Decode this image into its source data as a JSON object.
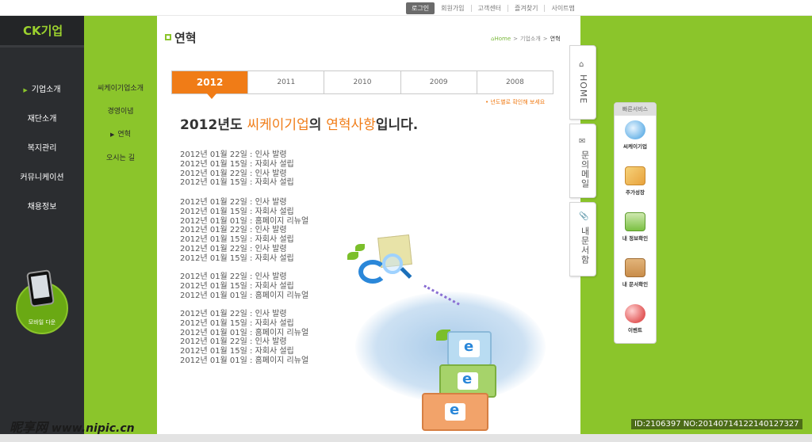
{
  "topbar": {
    "login": "로그인",
    "links": [
      "회원가입",
      "고객센터",
      "즐겨찾기",
      "사이트맵"
    ]
  },
  "logo": "CK기업",
  "leftnav": {
    "items": [
      {
        "label": "기업소개",
        "active": true
      },
      {
        "label": "재단소개",
        "active": false
      },
      {
        "label": "복지관리",
        "active": false
      },
      {
        "label": "커뮤니케이션",
        "active": false
      },
      {
        "label": "채용정보",
        "active": false
      }
    ],
    "mobile_label": "모바일 다운"
  },
  "subnav": {
    "items": [
      {
        "label": "씨케이기업소개",
        "active": false
      },
      {
        "label": "경영이념",
        "active": false
      },
      {
        "label": "연혁",
        "active": true
      },
      {
        "label": "오시는 길",
        "active": false
      }
    ]
  },
  "page": {
    "title": "연혁",
    "breadcrumb": [
      "Home",
      "기업소개",
      "연혁"
    ]
  },
  "tabs": [
    "2012",
    "2011",
    "2010",
    "2009",
    "2008"
  ],
  "year_note": "• 년도별로 확인해 보세요",
  "headline": {
    "pre": "2012년도 ",
    "company": "씨케이기업",
    "mid": "의 ",
    "topic": "연혁사항",
    "post": "입니다."
  },
  "history": [
    [
      "2012년 01월 22일 : 인사 발령",
      "2012년 01월 15일 : 자회사 설립",
      "2012년 01월 22일 : 인사 발령",
      "2012년 01월 15일 : 자회사 설립"
    ],
    [
      "2012년 01월 22일 : 인사 발령",
      "2012년 01월 15일 : 자회사 설립",
      "2012년 01월 01일 : 홈페이지 리뉴얼",
      "2012년 01월 22일 : 인사 발령",
      "2012년 01월 15일 : 자회사 설립",
      "2012년 01월 22일 : 인사 발령",
      "2012년 01월 15일 : 자회사 설립"
    ],
    [
      "2012년 01월 22일 : 인사 발령",
      "2012년 01월 15일 : 자회사 설립",
      "2012년 01월 01일 : 홈페이지 리뉴얼"
    ],
    [
      "2012년 01월 22일 : 인사 발령",
      "2012년 01월 15일 : 자회사 설립",
      "2012년 01월 01일 : 홈페이지 리뉴얼",
      "2012년 01월 22일 : 인사 발령",
      "2012년 01월 15일 : 자회사 설립",
      "2012년 01월 01일 : 홈페이지 리뉴얼"
    ]
  ],
  "vtabs": [
    {
      "label": "HOME",
      "icon": "home-icon"
    },
    {
      "label": "문의메일",
      "icon": "mail-icon"
    },
    {
      "label": "내문서함",
      "icon": "clip-icon"
    }
  ],
  "quick": {
    "title": "빠른서비스",
    "items": [
      {
        "label": "씨케이기업",
        "icon": "globe-icon",
        "color": "#6fb6e8"
      },
      {
        "label": "주가성장",
        "icon": "chart-up-icon",
        "color": "#e8a23c"
      },
      {
        "label": "내 정보확인",
        "icon": "store-icon",
        "color": "#7bc043"
      },
      {
        "label": "내 문서확인",
        "icon": "box-icon",
        "color": "#c98d4a"
      },
      {
        "label": "이벤트",
        "icon": "balloon-icon",
        "color": "#e25b5b"
      }
    ]
  },
  "watermarks": {
    "left": "昵享网",
    "left_site": " www.nipic.cn",
    "right": "ID:2106397 NO:20140714122140127327"
  },
  "colors": {
    "accent_green": "#8bc52b",
    "accent_orange": "#f07c17",
    "dark_nav": "#2b2d30"
  }
}
